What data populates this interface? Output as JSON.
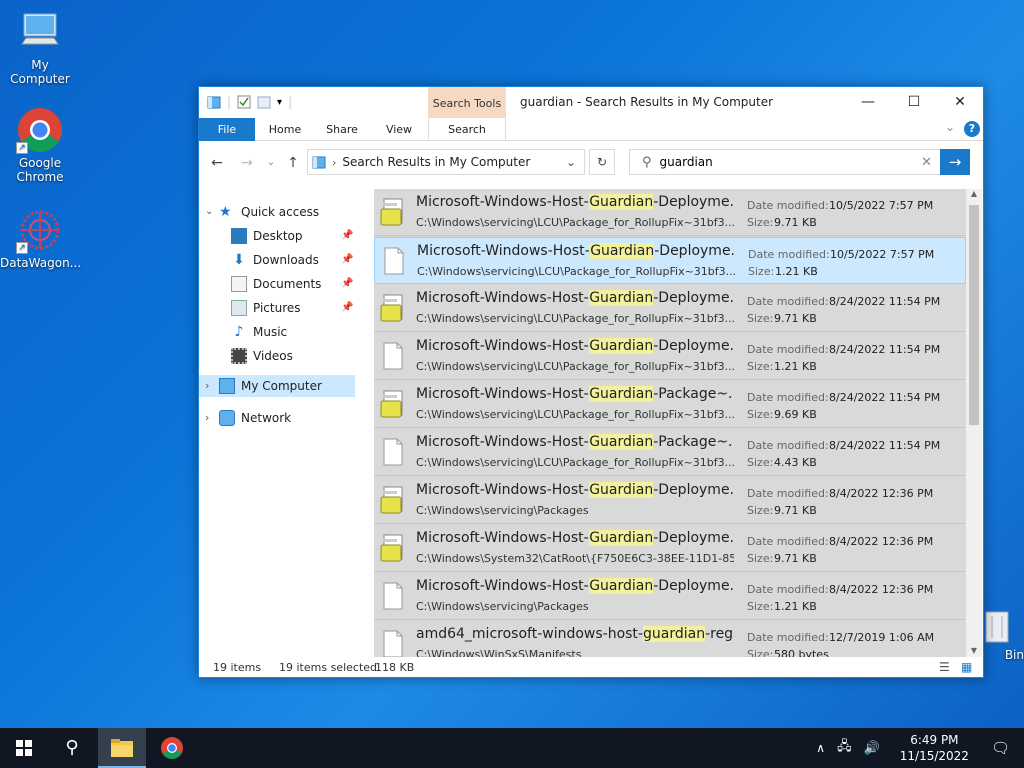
{
  "desktop": {
    "icons": [
      {
        "label": "My Computer",
        "icon": "computer-icon"
      },
      {
        "label": "Google Chrome",
        "icon": "chrome-icon"
      },
      {
        "label": "DataWagon...",
        "icon": "datawagon-icon"
      },
      {
        "label": "Bin",
        "icon": "recycle-bin-icon"
      }
    ]
  },
  "window": {
    "title": "guardian - Search Results in My Computer",
    "context_tab": "Search Tools",
    "ribbon_tabs": [
      "File",
      "Home",
      "Share",
      "View",
      "Search"
    ],
    "address": "Search Results in My Computer",
    "search_value": "guardian",
    "nav": {
      "quick_access": "Quick access",
      "items": [
        "Desktop",
        "Downloads",
        "Documents",
        "Pictures",
        "Music",
        "Videos"
      ],
      "my_computer": "My Computer",
      "network": "Network"
    },
    "date_label": "Date modified:",
    "size_label": "Size:",
    "files": [
      {
        "pre": "Microsoft-Windows-Host-",
        "hl": "Guardian",
        "post": "-Deployme...",
        "path": "C:\\Windows\\servicing\\LCU\\Package_for_RollupFix~31bf3...",
        "date": "10/5/2022 7:57 PM",
        "size": "9.71 KB",
        "type": "cat"
      },
      {
        "pre": "Microsoft-Windows-Host-",
        "hl": "Guardian",
        "post": "-Deployme...",
        "path": "C:\\Windows\\servicing\\LCU\\Package_for_RollupFix~31bf3...",
        "date": "10/5/2022 7:57 PM",
        "size": "1.21 KB",
        "type": "doc"
      },
      {
        "pre": "Microsoft-Windows-Host-",
        "hl": "Guardian",
        "post": "-Deployme...",
        "path": "C:\\Windows\\servicing\\LCU\\Package_for_RollupFix~31bf3...",
        "date": "8/24/2022 11:54 PM",
        "size": "9.71 KB",
        "type": "cat"
      },
      {
        "pre": "Microsoft-Windows-Host-",
        "hl": "Guardian",
        "post": "-Deployme...",
        "path": "C:\\Windows\\servicing\\LCU\\Package_for_RollupFix~31bf3...",
        "date": "8/24/2022 11:54 PM",
        "size": "1.21 KB",
        "type": "doc"
      },
      {
        "pre": "Microsoft-Windows-Host-",
        "hl": "Guardian",
        "post": "-Package~...",
        "path": "C:\\Windows\\servicing\\LCU\\Package_for_RollupFix~31bf3...",
        "date": "8/24/2022 11:54 PM",
        "size": "9.69 KB",
        "type": "cat"
      },
      {
        "pre": "Microsoft-Windows-Host-",
        "hl": "Guardian",
        "post": "-Package~...",
        "path": "C:\\Windows\\servicing\\LCU\\Package_for_RollupFix~31bf3...",
        "date": "8/24/2022 11:54 PM",
        "size": "4.43 KB",
        "type": "doc"
      },
      {
        "pre": "Microsoft-Windows-Host-",
        "hl": "Guardian",
        "post": "-Deployme...",
        "path": "C:\\Windows\\servicing\\Packages",
        "date": "8/4/2022 12:36 PM",
        "size": "9.71 KB",
        "type": "cat"
      },
      {
        "pre": "Microsoft-Windows-Host-",
        "hl": "Guardian",
        "post": "-Deployme...",
        "path": "C:\\Windows\\System32\\CatRoot\\{F750E6C3-38EE-11D1-85...",
        "date": "8/4/2022 12:36 PM",
        "size": "9.71 KB",
        "type": "cat"
      },
      {
        "pre": "Microsoft-Windows-Host-",
        "hl": "Guardian",
        "post": "-Deployme...",
        "path": "C:\\Windows\\servicing\\Packages",
        "date": "8/4/2022 12:36 PM",
        "size": "1.21 KB",
        "type": "doc"
      },
      {
        "pre": "amd64_microsoft-windows-host-",
        "hl": "guardian",
        "post": "-reg...",
        "path": "C:\\Windows\\WinSxS\\Manifests",
        "date": "12/7/2019 1:06 AM",
        "size": "580 bytes",
        "type": "doc"
      }
    ],
    "status": {
      "count": "19 items",
      "selected": "19 items selected",
      "size": "118 KB"
    }
  },
  "taskbar": {
    "time": "6:49 PM",
    "date": "11/15/2022"
  },
  "colors": {
    "accent": "#1979ca",
    "highlight": "#f4f19b",
    "selection": "#cce8ff"
  }
}
